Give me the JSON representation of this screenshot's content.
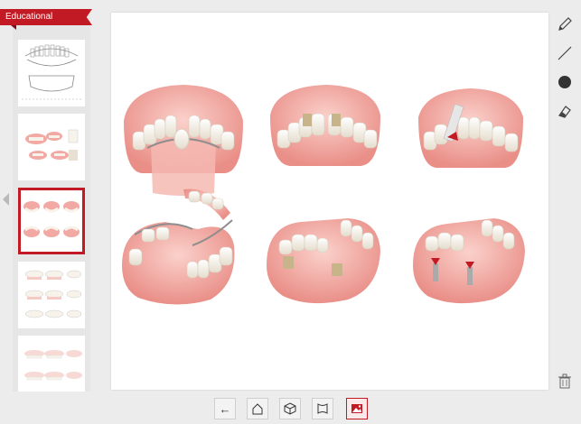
{
  "sidebar": {
    "ribbon_label": "Educational",
    "thumbnails": [
      "panoramic-xray",
      "dental-overview",
      "prosthetics-comparison",
      "full-dentures",
      "dental-arches"
    ],
    "selected_index": 2
  },
  "toolbar": {
    "tools": [
      "pencil-icon",
      "line-icon",
      "circle-icon",
      "eraser-icon",
      "trash-icon"
    ]
  },
  "bottom_bar": {
    "back_label": "←",
    "buttons": [
      "back-arrow-icon",
      "home-icon",
      "cube-icon",
      "arch-icon",
      "image-icon"
    ],
    "active": "image-icon"
  },
  "canvas": {
    "illustrations": [
      "removable-partial-denture-upper",
      "bridge-upper",
      "implant-crown-upper",
      "removable-partial-denture-lower",
      "bridge-lower",
      "implant-bridge-lower"
    ]
  },
  "colors": {
    "accent": "#c21a24",
    "gum": "#f2a9a3",
    "tooth": "#f7f3ea"
  }
}
